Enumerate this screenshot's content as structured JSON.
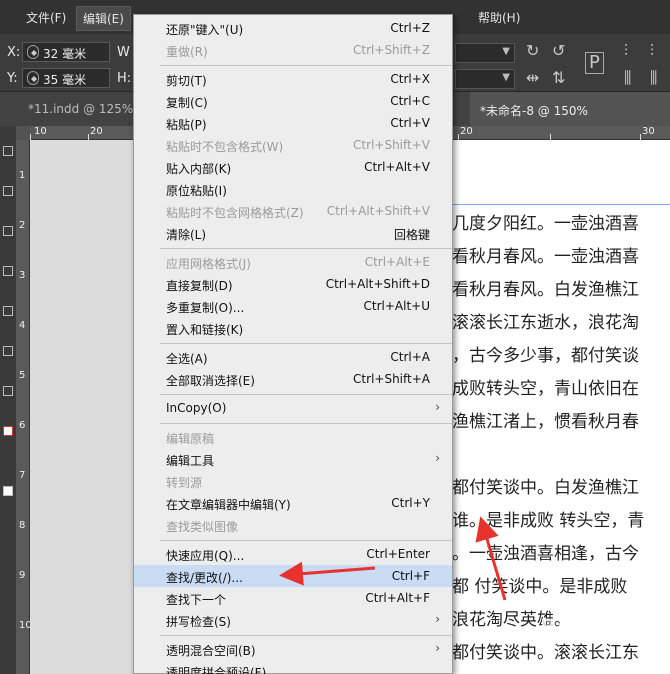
{
  "menubar": {
    "items": [
      {
        "label": "文件(F)"
      },
      {
        "label": "编辑(E)"
      },
      {
        "label": "帮助(H)"
      }
    ]
  },
  "controlbar": {
    "x_label": "X:",
    "x_value": "32 毫米",
    "y_label": "Y:",
    "y_value": "35 毫米",
    "w_label": "W",
    "h_label": "H:"
  },
  "tabs": [
    {
      "label": "*11.indd @ 125%"
    },
    {
      "label": "*未命名-8 @ 150%"
    }
  ],
  "hruler": {
    "labels": [
      "10",
      "20",
      "20",
      "30"
    ]
  },
  "vruler": {
    "labels": [
      "1",
      "2",
      "3",
      "4",
      "5",
      "6",
      "7",
      "8",
      "9",
      "10"
    ]
  },
  "document_text": {
    "lines": [
      "几度夕阳红。一壶浊酒喜",
      "看秋月春风。一壶浊酒喜",
      "看秋月春风。白发渔樵江",
      "滚滚长江东逝水，浪花淘",
      "，古今多少事，都付笑谈",
      "成败转头空，青山依旧在",
      "渔樵江渚上，惯看秋月春",
      "",
      "都付笑谈中。白发渔樵江",
      "谁。是非成败 转头空，青",
      "。一壶浊酒喜相逢，古今",
      "都 付笑谈中。是非成败",
      "浪花淘尽英雄。",
      "都付笑谈中。滚滚长江东"
    ]
  },
  "menu": {
    "items": [
      {
        "label": "还原\"键入\"(U)",
        "shortcut": "Ctrl+Z",
        "disabled": false
      },
      {
        "label": "重做(R)",
        "shortcut": "Ctrl+Shift+Z",
        "disabled": true
      },
      {
        "label": "剪切(T)",
        "shortcut": "Ctrl+X",
        "disabled": false
      },
      {
        "label": "复制(C)",
        "shortcut": "Ctrl+C",
        "disabled": false
      },
      {
        "label": "粘贴(P)",
        "shortcut": "Ctrl+V",
        "disabled": false
      },
      {
        "label": "粘贴时不包含格式(W)",
        "shortcut": "Ctrl+Shift+V",
        "disabled": true
      },
      {
        "label": "贴入内部(K)",
        "shortcut": "Ctrl+Alt+V",
        "disabled": false
      },
      {
        "label": "原位粘贴(I)",
        "shortcut": "",
        "disabled": false
      },
      {
        "label": "粘贴时不包含网格格式(Z)",
        "shortcut": "Ctrl+Alt+Shift+V",
        "disabled": true
      },
      {
        "label": "清除(L)",
        "shortcut": "回格键",
        "disabled": false
      },
      {
        "label": "应用网格格式(J)",
        "shortcut": "Ctrl+Alt+E",
        "disabled": true
      },
      {
        "label": "直接复制(D)",
        "shortcut": "Ctrl+Alt+Shift+D",
        "disabled": false
      },
      {
        "label": "多重复制(O)...",
        "shortcut": "Ctrl+Alt+U",
        "disabled": false
      },
      {
        "label": "置入和链接(K)",
        "shortcut": "",
        "disabled": false
      },
      {
        "label": "全选(A)",
        "shortcut": "Ctrl+A",
        "disabled": false
      },
      {
        "label": "全部取消选择(E)",
        "shortcut": "Ctrl+Shift+A",
        "disabled": false
      },
      {
        "label": "InCopy(O)",
        "shortcut": "",
        "disabled": false,
        "submenu": true
      },
      {
        "label": "编辑原稿",
        "shortcut": "",
        "disabled": true
      },
      {
        "label": "编辑工具",
        "shortcut": "",
        "disabled": false,
        "submenu": true
      },
      {
        "label": "转到源",
        "shortcut": "",
        "disabled": true
      },
      {
        "label": "在文章编辑器中编辑(Y)",
        "shortcut": "Ctrl+Y",
        "disabled": false
      },
      {
        "label": "查找类似图像",
        "shortcut": "",
        "disabled": true
      },
      {
        "label": "快速应用(Q)...",
        "shortcut": "Ctrl+Enter",
        "disabled": false
      },
      {
        "label": "查找/更改(/)...",
        "shortcut": "Ctrl+F",
        "disabled": false,
        "highlighted": true
      },
      {
        "label": "查找下一个",
        "shortcut": "Ctrl+Alt+F",
        "disabled": false
      },
      {
        "label": "拼写检查(S)",
        "shortcut": "",
        "disabled": false,
        "submenu": true
      },
      {
        "label": "透明混合空间(B)",
        "shortcut": "",
        "disabled": false,
        "submenu": true
      },
      {
        "label": "透明度拼合预设(F)...",
        "shortcut": "",
        "disabled": false
      }
    ]
  },
  "colors": {
    "annotation_arrow": "#e8322e",
    "menu_highlight": "#c9dcf3"
  },
  "watermark": "Bai 经验"
}
